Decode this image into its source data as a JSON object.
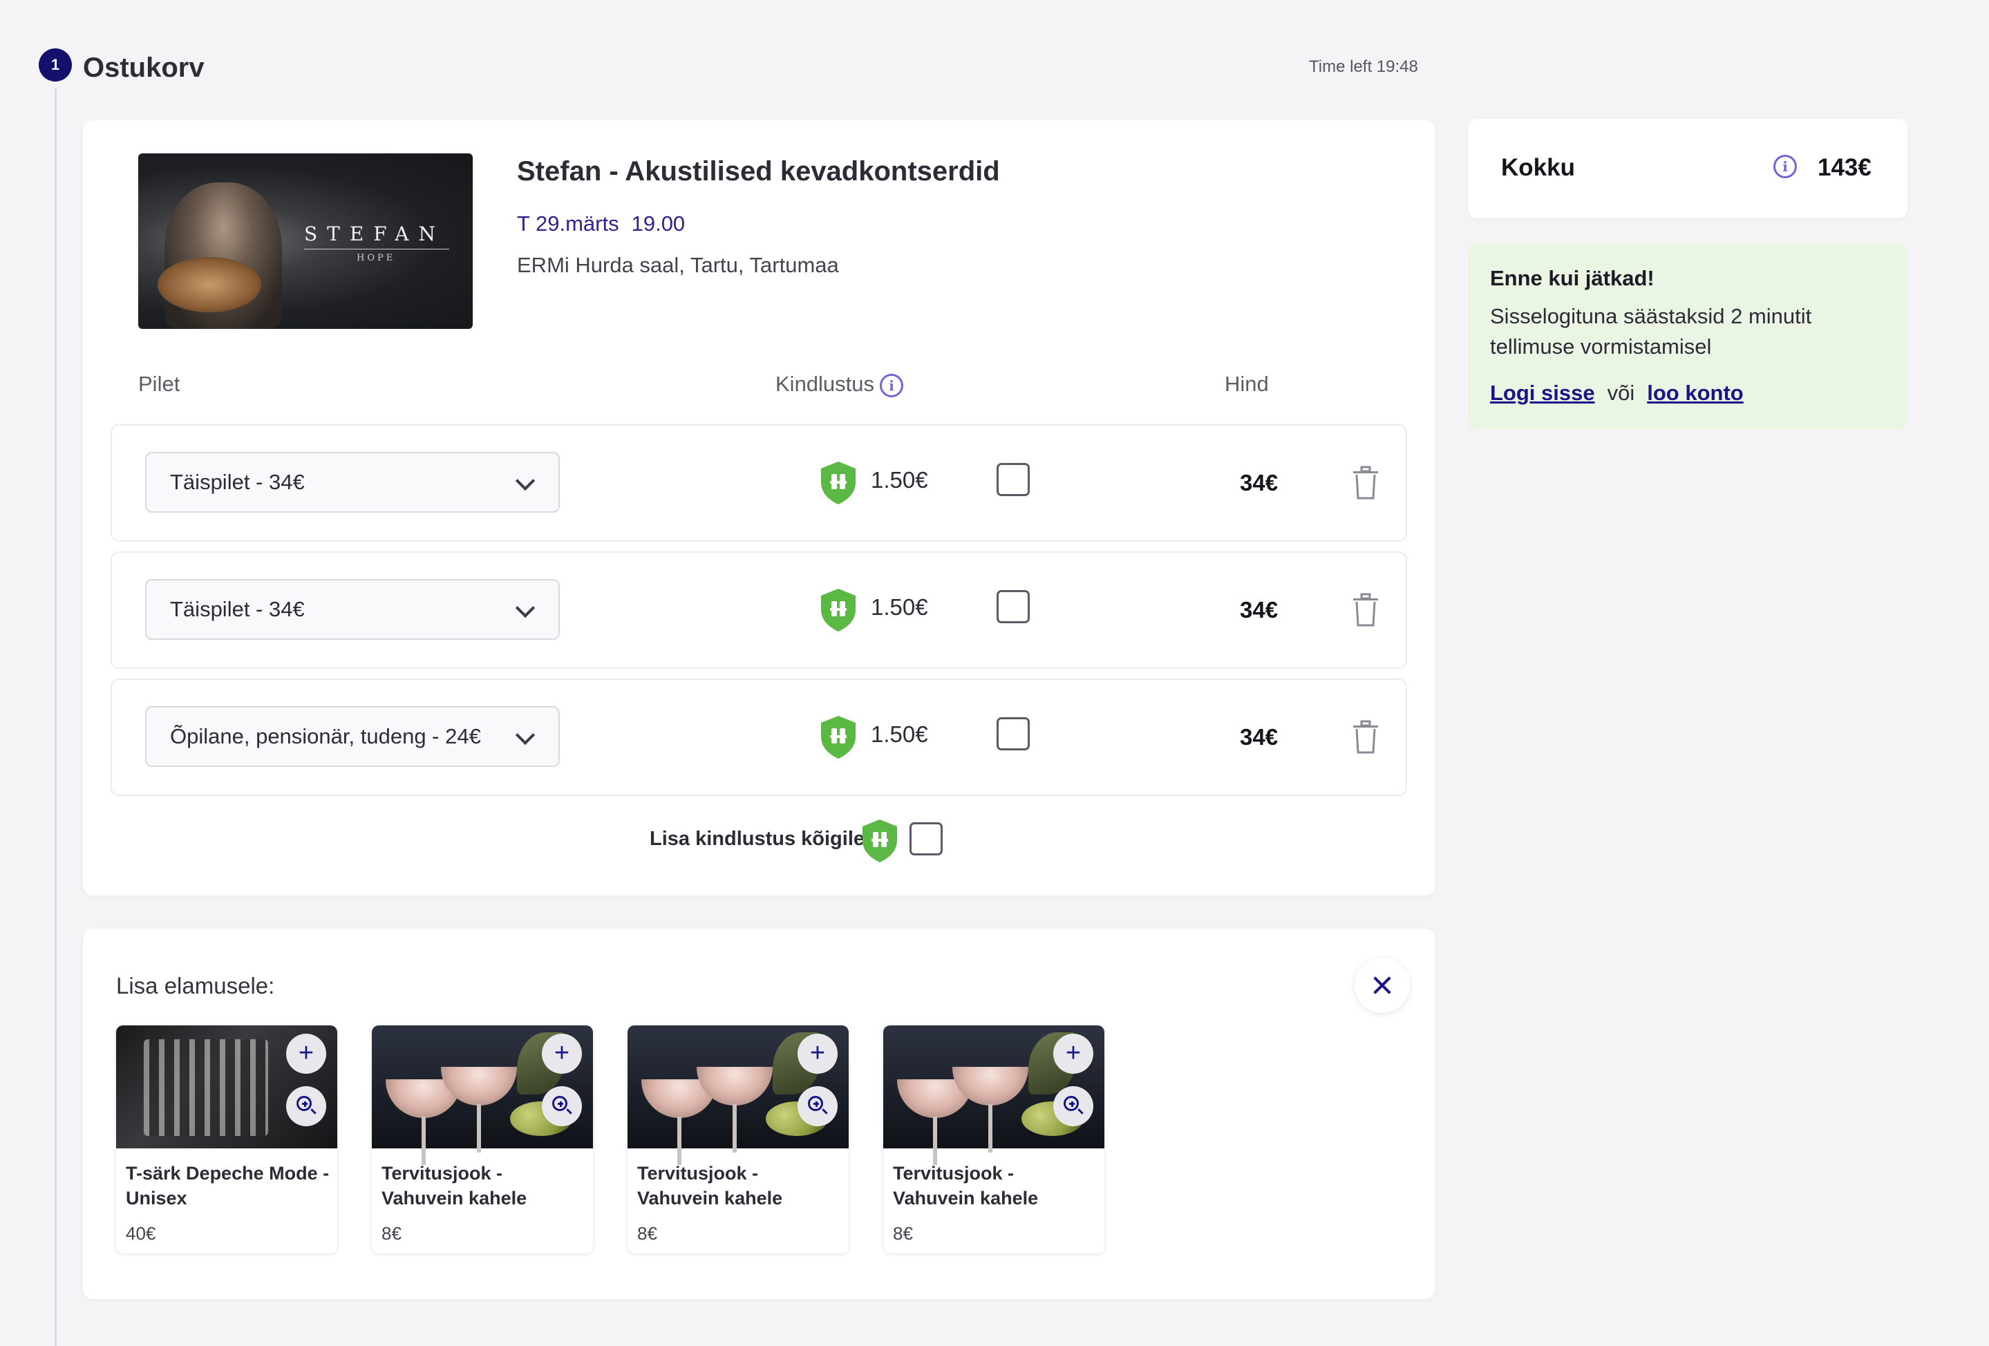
{
  "step": {
    "number": "1",
    "title": "Ostukorv",
    "time_left": "Time left 19:48"
  },
  "event": {
    "title": "Stefan - Akustilised kevadkontserdid",
    "date": "T 29.märts",
    "time": "19.00",
    "venue": "ERMi Hurda saal, Tartu, Tartumaa",
    "image_brand": "STEFAN",
    "image_sub": "HOPE"
  },
  "table": {
    "col_tickets": "Pilet",
    "col_insurance": "Kindlustus",
    "col_price": "Hind"
  },
  "tickets": [
    {
      "type": "Täispilet - 34€",
      "insurance_price": "1.50€",
      "insured": false,
      "price": "34€"
    },
    {
      "type": "Täispilet - 34€",
      "insurance_price": "1.50€",
      "insured": false,
      "price": "34€"
    },
    {
      "type": "Õpilane, pensionär, tudeng - 24€",
      "insurance_price": "1.50€",
      "insured": false,
      "price": "34€"
    }
  ],
  "insure_all_label": "Lisa kindlustus kõigile",
  "extras": {
    "title": "Lisa elamusele:",
    "products": [
      {
        "name": "T-särk Depeche Mode - Unisex",
        "price": "40€"
      },
      {
        "name": "Tervitusjook - Vahuvein kahele",
        "price": "8€"
      },
      {
        "name": "Tervitusjook - Vahuvein kahele",
        "price": "8€"
      },
      {
        "name": "Tervitusjook - Vahuvein kahele",
        "price": "8€"
      }
    ]
  },
  "summary": {
    "label": "Kokku",
    "total": "143€"
  },
  "notice": {
    "title": "Enne kui jätkad!",
    "text": "Sisselogituna säästaksid 2 minutit tellimuse vormistamisel",
    "login_link": "Logi sisse",
    "or": "või",
    "register_link": "loo konto"
  },
  "colors": {
    "brand": "#14106b",
    "accent": "#6f66d6",
    "shield": "#5cb845",
    "notice_bg": "#eaf6e3"
  },
  "icons": [
    "info-icon",
    "chevron-down-icon",
    "shield-icon",
    "trash-icon",
    "close-icon",
    "plus-icon",
    "zoom-icon"
  ]
}
